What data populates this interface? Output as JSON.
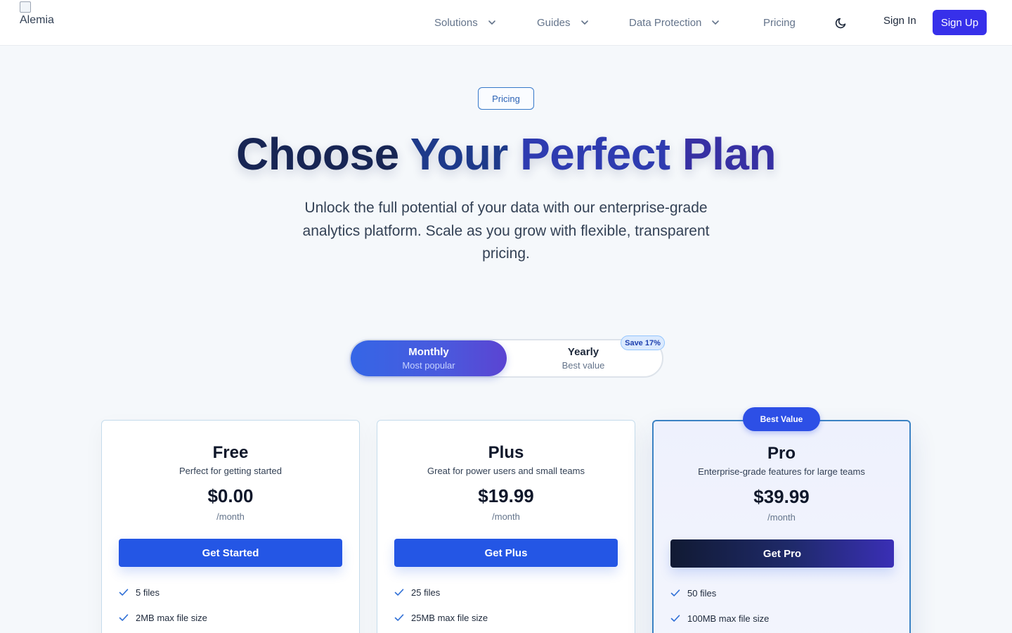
{
  "header": {
    "logo_alt": "Alemia",
    "nav": [
      {
        "label": "Solutions"
      },
      {
        "label": "Guides"
      },
      {
        "label": "Data Protection"
      },
      {
        "label": "Pricing"
      }
    ],
    "sign_in": "Sign In",
    "sign_up": "Sign Up"
  },
  "hero": {
    "badge": "Pricing",
    "title_words": [
      "Choose",
      "Your",
      "Perfect",
      "Plan"
    ],
    "subtitle": "Unlock the full potential of your data with our enterprise-grade analytics platform. Scale as you grow with flexible, transparent pricing."
  },
  "billing": {
    "monthly": {
      "label": "Monthly",
      "sub": "Most popular"
    },
    "yearly": {
      "label": "Yearly",
      "sub": "Best value"
    },
    "save_badge": "Save 17%"
  },
  "plans": [
    {
      "name": "Free",
      "desc": "Perfect for getting started",
      "price": "$0.00",
      "period": "/month",
      "cta": "Get Started",
      "features": [
        "5 files",
        "2MB max file size"
      ]
    },
    {
      "name": "Plus",
      "desc": "Great for power users and small teams",
      "price": "$19.99",
      "period": "/month",
      "cta": "Get Plus",
      "features": [
        "25 files",
        "25MB max file size"
      ]
    },
    {
      "name": "Pro",
      "badge": "Best Value",
      "desc": "Enterprise-grade features for large teams",
      "price": "$39.99",
      "period": "/month",
      "cta": "Get Pro",
      "features": [
        "50 files",
        "100MB max file size"
      ]
    }
  ],
  "colors": {
    "primary": "#3730ea",
    "button_blue": "#2456e5",
    "check": "#2f6fd6"
  }
}
